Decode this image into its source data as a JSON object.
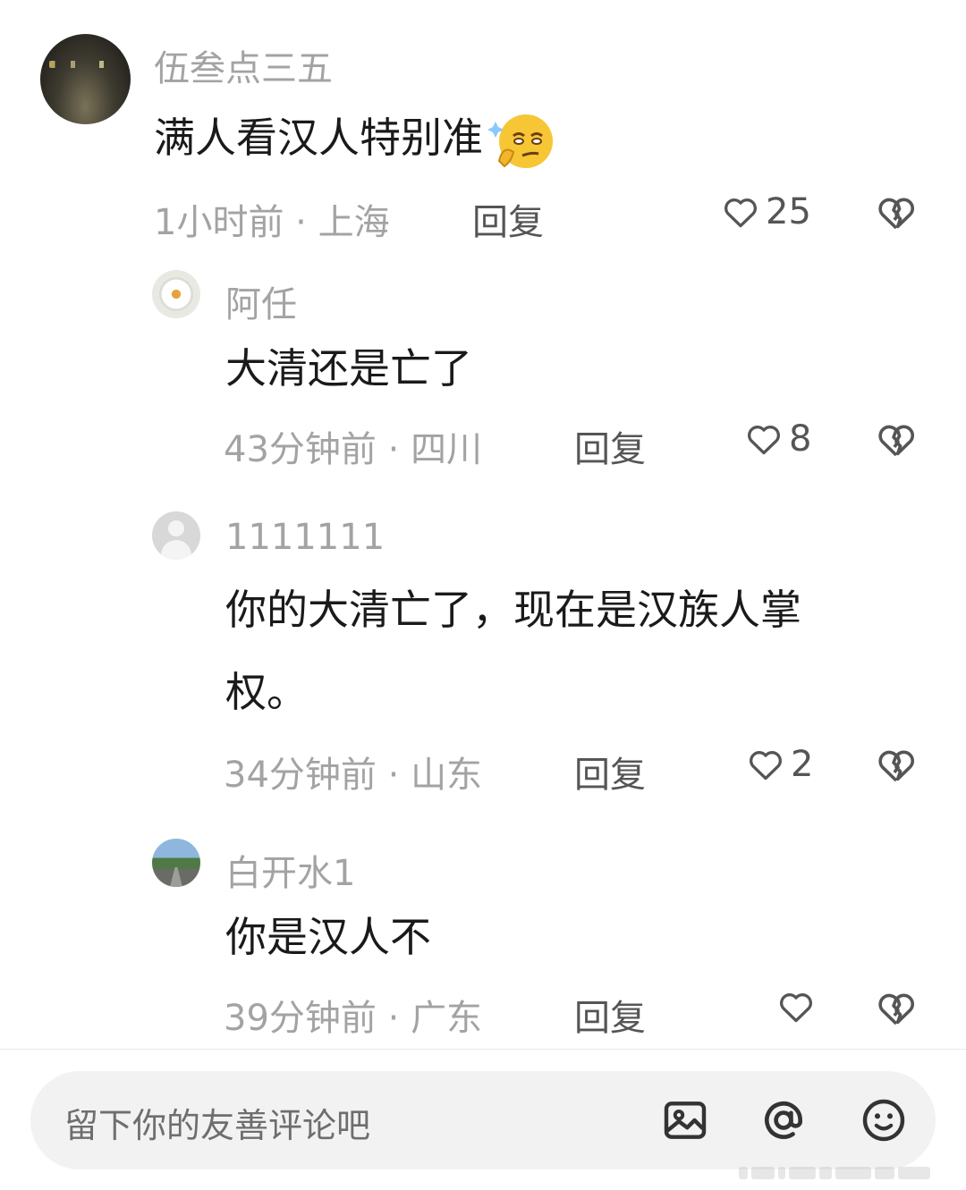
{
  "comments": [
    {
      "username": "伍叁点三五",
      "text": "满人看汉人特别准",
      "emoji": "smirk-thinking-emoji",
      "time": "1小时前",
      "sep": "·",
      "location": "上海",
      "reply": "回复",
      "likes": "25"
    },
    {
      "username": "阿任",
      "text": "大清还是亡了",
      "time": "43分钟前",
      "sep": "·",
      "location": "四川",
      "reply": "回复",
      "likes": "8"
    },
    {
      "username": "1111111",
      "text_line1": "你的大清亡了，现在是汉族人掌",
      "text_line2": "权。",
      "time": "34分钟前",
      "sep": "·",
      "location": "山东",
      "reply": "回复",
      "likes": "2"
    },
    {
      "username": "白开水1",
      "text": "你是汉人不",
      "time": "39分钟前",
      "sep": "·",
      "location": "广东",
      "reply": "回复",
      "likes": ""
    }
  ],
  "input": {
    "placeholder": "留下你的友善评论吧",
    "icons": [
      "image-icon",
      "at-icon",
      "emoji-icon"
    ]
  },
  "colors": {
    "username": "#a3a3a3",
    "text": "#1a1a1a",
    "action": "#555555",
    "input_bg": "#f2f2f2"
  }
}
